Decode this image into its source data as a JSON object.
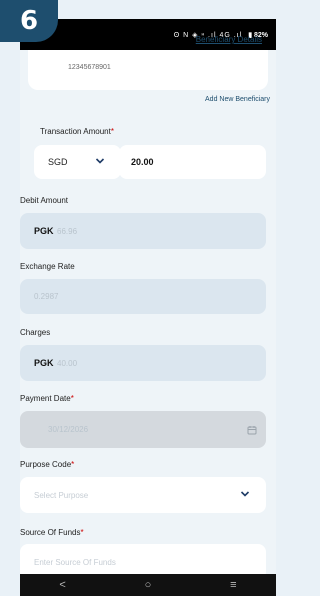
{
  "step_number": "6",
  "status_bar": {
    "icons": "ʘ N ◈ ᵸ .ıl 4G .ıl",
    "battery": "▮ 82%"
  },
  "beneficiary": {
    "account_number": "12345678901",
    "link_text": "Beneficiary Details"
  },
  "add_beneficiary": "Add New Beneficiary",
  "transaction_amount": {
    "label": "Transaction Amount",
    "required": "*",
    "currency": "SGD",
    "value": "20.00"
  },
  "debit_amount": {
    "label": "Debit Amount",
    "currency": "PGK",
    "value": "66.96"
  },
  "exchange_rate": {
    "label": "Exchange Rate",
    "value": "0.2987"
  },
  "charges": {
    "label": "Charges",
    "currency": "PGK",
    "value": "40.00"
  },
  "payment_date": {
    "label": "Payment Date",
    "required": "*",
    "value": "30/12/2026"
  },
  "purpose_code": {
    "label": "Purpose Code",
    "required": "*",
    "placeholder": "Select Purpose"
  },
  "source_of_funds": {
    "label": "Source Of Funds",
    "required": "*",
    "placeholder": "Enter Source Of Funds"
  },
  "nav": {
    "back": "<",
    "home": "○",
    "recents": "≡"
  },
  "colors": {
    "brand": "#1e4e6e",
    "required": "#cc0000",
    "field_readonly": "#dbe6ef",
    "field_disabled": "#d4d9de"
  }
}
